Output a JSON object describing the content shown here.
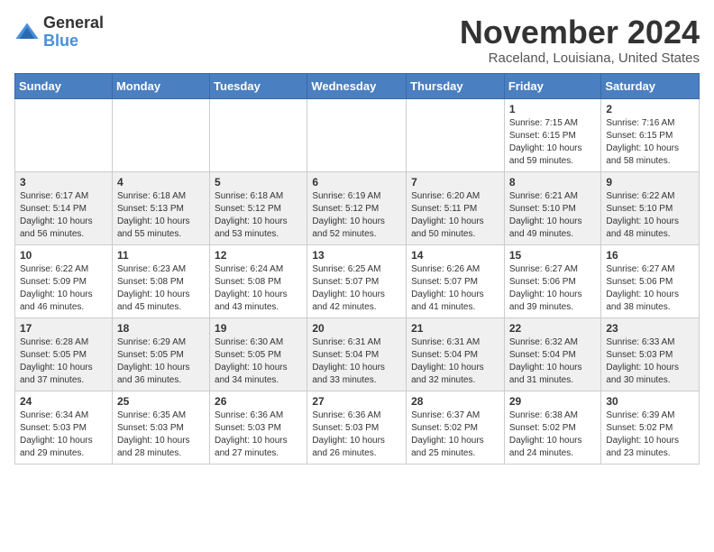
{
  "logo": {
    "general": "General",
    "blue": "Blue"
  },
  "title": "November 2024",
  "location": "Raceland, Louisiana, United States",
  "days_of_week": [
    "Sunday",
    "Monday",
    "Tuesday",
    "Wednesday",
    "Thursday",
    "Friday",
    "Saturday"
  ],
  "weeks": [
    [
      {
        "day": "",
        "info": ""
      },
      {
        "day": "",
        "info": ""
      },
      {
        "day": "",
        "info": ""
      },
      {
        "day": "",
        "info": ""
      },
      {
        "day": "",
        "info": ""
      },
      {
        "day": "1",
        "info": "Sunrise: 7:15 AM\nSunset: 6:15 PM\nDaylight: 10 hours and 59 minutes."
      },
      {
        "day": "2",
        "info": "Sunrise: 7:16 AM\nSunset: 6:15 PM\nDaylight: 10 hours and 58 minutes."
      }
    ],
    [
      {
        "day": "3",
        "info": "Sunrise: 6:17 AM\nSunset: 5:14 PM\nDaylight: 10 hours and 56 minutes."
      },
      {
        "day": "4",
        "info": "Sunrise: 6:18 AM\nSunset: 5:13 PM\nDaylight: 10 hours and 55 minutes."
      },
      {
        "day": "5",
        "info": "Sunrise: 6:18 AM\nSunset: 5:12 PM\nDaylight: 10 hours and 53 minutes."
      },
      {
        "day": "6",
        "info": "Sunrise: 6:19 AM\nSunset: 5:12 PM\nDaylight: 10 hours and 52 minutes."
      },
      {
        "day": "7",
        "info": "Sunrise: 6:20 AM\nSunset: 5:11 PM\nDaylight: 10 hours and 50 minutes."
      },
      {
        "day": "8",
        "info": "Sunrise: 6:21 AM\nSunset: 5:10 PM\nDaylight: 10 hours and 49 minutes."
      },
      {
        "day": "9",
        "info": "Sunrise: 6:22 AM\nSunset: 5:10 PM\nDaylight: 10 hours and 48 minutes."
      }
    ],
    [
      {
        "day": "10",
        "info": "Sunrise: 6:22 AM\nSunset: 5:09 PM\nDaylight: 10 hours and 46 minutes."
      },
      {
        "day": "11",
        "info": "Sunrise: 6:23 AM\nSunset: 5:08 PM\nDaylight: 10 hours and 45 minutes."
      },
      {
        "day": "12",
        "info": "Sunrise: 6:24 AM\nSunset: 5:08 PM\nDaylight: 10 hours and 43 minutes."
      },
      {
        "day": "13",
        "info": "Sunrise: 6:25 AM\nSunset: 5:07 PM\nDaylight: 10 hours and 42 minutes."
      },
      {
        "day": "14",
        "info": "Sunrise: 6:26 AM\nSunset: 5:07 PM\nDaylight: 10 hours and 41 minutes."
      },
      {
        "day": "15",
        "info": "Sunrise: 6:27 AM\nSunset: 5:06 PM\nDaylight: 10 hours and 39 minutes."
      },
      {
        "day": "16",
        "info": "Sunrise: 6:27 AM\nSunset: 5:06 PM\nDaylight: 10 hours and 38 minutes."
      }
    ],
    [
      {
        "day": "17",
        "info": "Sunrise: 6:28 AM\nSunset: 5:05 PM\nDaylight: 10 hours and 37 minutes."
      },
      {
        "day": "18",
        "info": "Sunrise: 6:29 AM\nSunset: 5:05 PM\nDaylight: 10 hours and 36 minutes."
      },
      {
        "day": "19",
        "info": "Sunrise: 6:30 AM\nSunset: 5:05 PM\nDaylight: 10 hours and 34 minutes."
      },
      {
        "day": "20",
        "info": "Sunrise: 6:31 AM\nSunset: 5:04 PM\nDaylight: 10 hours and 33 minutes."
      },
      {
        "day": "21",
        "info": "Sunrise: 6:31 AM\nSunset: 5:04 PM\nDaylight: 10 hours and 32 minutes."
      },
      {
        "day": "22",
        "info": "Sunrise: 6:32 AM\nSunset: 5:04 PM\nDaylight: 10 hours and 31 minutes."
      },
      {
        "day": "23",
        "info": "Sunrise: 6:33 AM\nSunset: 5:03 PM\nDaylight: 10 hours and 30 minutes."
      }
    ],
    [
      {
        "day": "24",
        "info": "Sunrise: 6:34 AM\nSunset: 5:03 PM\nDaylight: 10 hours and 29 minutes."
      },
      {
        "day": "25",
        "info": "Sunrise: 6:35 AM\nSunset: 5:03 PM\nDaylight: 10 hours and 28 minutes."
      },
      {
        "day": "26",
        "info": "Sunrise: 6:36 AM\nSunset: 5:03 PM\nDaylight: 10 hours and 27 minutes."
      },
      {
        "day": "27",
        "info": "Sunrise: 6:36 AM\nSunset: 5:03 PM\nDaylight: 10 hours and 26 minutes."
      },
      {
        "day": "28",
        "info": "Sunrise: 6:37 AM\nSunset: 5:02 PM\nDaylight: 10 hours and 25 minutes."
      },
      {
        "day": "29",
        "info": "Sunrise: 6:38 AM\nSunset: 5:02 PM\nDaylight: 10 hours and 24 minutes."
      },
      {
        "day": "30",
        "info": "Sunrise: 6:39 AM\nSunset: 5:02 PM\nDaylight: 10 hours and 23 minutes."
      }
    ]
  ]
}
